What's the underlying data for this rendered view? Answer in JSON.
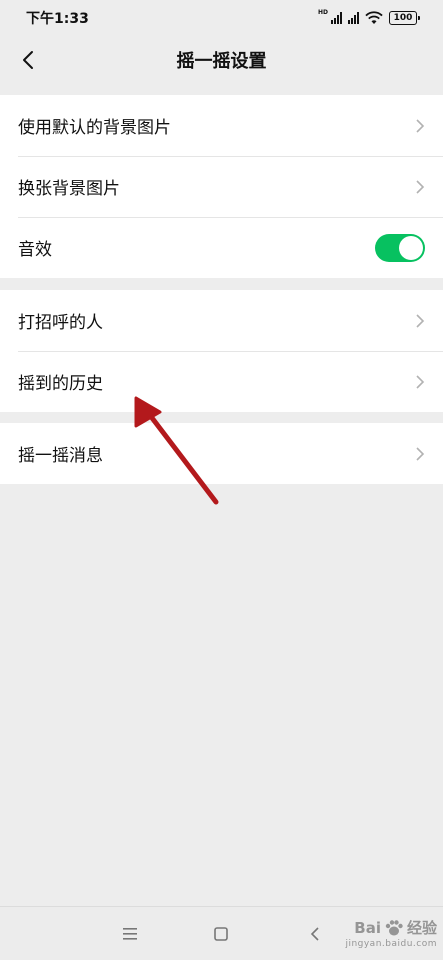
{
  "status": {
    "time": "下午1:33",
    "network_badge": "HD",
    "battery": "100"
  },
  "nav": {
    "title": "摇一摇设置",
    "back_icon": "chevron-left-icon"
  },
  "groups": [
    {
      "items": [
        {
          "label": "使用默认的背景图片",
          "type": "link"
        },
        {
          "label": "换张背景图片",
          "type": "link"
        },
        {
          "label": "音效",
          "type": "toggle",
          "on": true
        }
      ]
    },
    {
      "items": [
        {
          "label": "打招呼的人",
          "type": "link"
        },
        {
          "label": "摇到的历史",
          "type": "link"
        }
      ]
    },
    {
      "items": [
        {
          "label": "摇一摇消息",
          "type": "link"
        }
      ]
    }
  ],
  "annotation": {
    "arrow_color": "#b3191c",
    "points_to": "摇到的历史"
  },
  "colors": {
    "background": "#ededed",
    "toggle_on": "#07c160"
  },
  "watermark": {
    "brand": "Bai",
    "brand2": "经验",
    "sub": "jingyan.baidu.com"
  }
}
